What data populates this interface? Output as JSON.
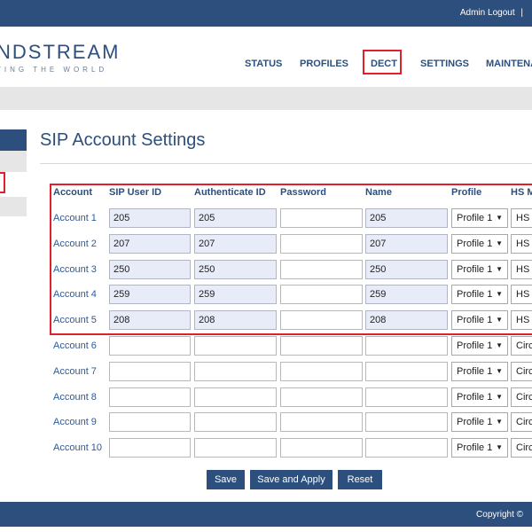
{
  "topbar": {
    "admin": "Admin",
    "logout": "Logout",
    "sep": "|"
  },
  "logo": {
    "brand": "NDSTREAM",
    "tagline": "TING THE WORLD"
  },
  "nav": {
    "status": "STATUS",
    "profiles": "PROFILES",
    "dect": "DECT",
    "settings": "SETTINGS",
    "maintenance": "MAINTENA"
  },
  "page": {
    "title": "SIP Account Settings"
  },
  "table": {
    "headers": {
      "account": "Account",
      "sip_user_id": "SIP User ID",
      "auth_id": "Authenticate ID",
      "password": "Password",
      "name": "Name",
      "profile": "Profile",
      "hs_mode": "HS M"
    },
    "rows": [
      {
        "account": "Account 1",
        "sip": "205",
        "auth": "205",
        "password": "",
        "name": "205",
        "profile": "Profile 1",
        "hs": "HS"
      },
      {
        "account": "Account 2",
        "sip": "207",
        "auth": "207",
        "password": "",
        "name": "207",
        "profile": "Profile 1",
        "hs": "HS"
      },
      {
        "account": "Account 3",
        "sip": "250",
        "auth": "250",
        "password": "",
        "name": "250",
        "profile": "Profile 1",
        "hs": "HS"
      },
      {
        "account": "Account 4",
        "sip": "259",
        "auth": "259",
        "password": "",
        "name": "259",
        "profile": "Profile 1",
        "hs": "HS"
      },
      {
        "account": "Account 5",
        "sip": "208",
        "auth": "208",
        "password": "",
        "name": "208",
        "profile": "Profile 1",
        "hs": "HS"
      },
      {
        "account": "Account 6",
        "sip": "",
        "auth": "",
        "password": "",
        "name": "",
        "profile": "Profile 1",
        "hs": "Circ"
      },
      {
        "account": "Account 7",
        "sip": "",
        "auth": "",
        "password": "",
        "name": "",
        "profile": "Profile 1",
        "hs": "Circ"
      },
      {
        "account": "Account 8",
        "sip": "",
        "auth": "",
        "password": "",
        "name": "",
        "profile": "Profile 1",
        "hs": "Circ"
      },
      {
        "account": "Account 9",
        "sip": "",
        "auth": "",
        "password": "",
        "name": "",
        "profile": "Profile 1",
        "hs": "Circ"
      },
      {
        "account": "Account 10",
        "sip": "",
        "auth": "",
        "password": "",
        "name": "",
        "profile": "Profile 1",
        "hs": "Circ"
      }
    ]
  },
  "buttons": {
    "save": "Save",
    "save_apply": "Save and Apply",
    "reset": "Reset"
  },
  "footer": {
    "copyright": "Copyright ©"
  },
  "colors": {
    "primary": "#2c4f7d",
    "highlight": "#e0202d",
    "filled_field": "#e8ecf8"
  }
}
